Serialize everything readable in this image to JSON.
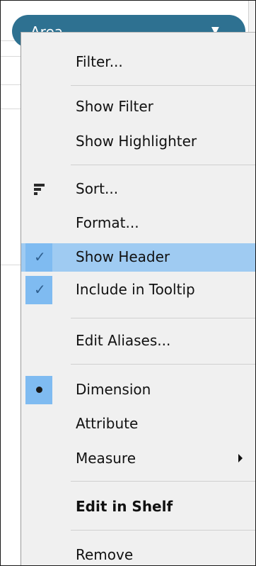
{
  "pill": {
    "label": "Area",
    "caret": "▼",
    "color": "#2e7191"
  },
  "menu": {
    "items": [
      {
        "label": "Filter..."
      },
      {
        "label": "Show Filter"
      },
      {
        "label": "Show Highlighter"
      },
      {
        "label": "Sort...",
        "icon": "sort-icon"
      },
      {
        "label": "Format..."
      },
      {
        "label": "Show Header",
        "checked": true,
        "highlighted": true
      },
      {
        "label": "Include in Tooltip",
        "checked": true
      },
      {
        "label": "Edit Aliases..."
      },
      {
        "label": "Dimension",
        "selected": true,
        "icon": "radio-bullet-icon"
      },
      {
        "label": "Attribute"
      },
      {
        "label": "Measure",
        "submenu": true,
        "icon": "submenu-arrow-icon"
      },
      {
        "label": "Edit in Shelf",
        "bold": true
      },
      {
        "label": "Remove"
      }
    ],
    "check_glyph": "✓",
    "highlight_color": "#9fcbf2",
    "check_bg_color": "#7fbbf1"
  }
}
